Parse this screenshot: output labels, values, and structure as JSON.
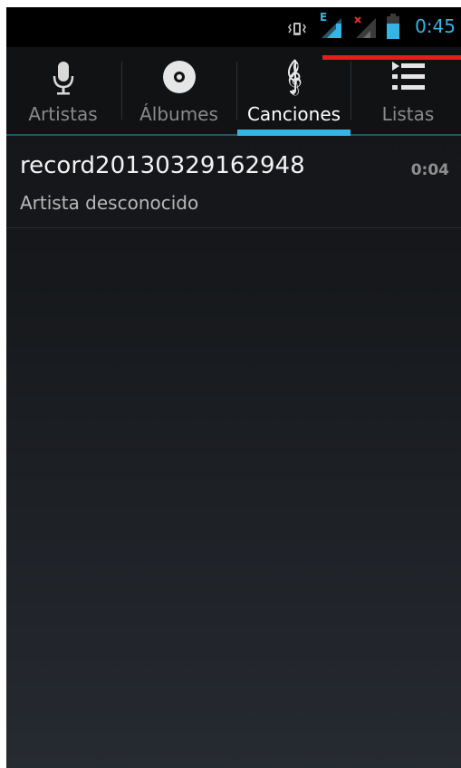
{
  "status_bar": {
    "time": "0:45",
    "signal_1_label": "E",
    "icons": [
      "vibrate-icon",
      "signal-e-icon",
      "signal-no-sim-icon",
      "battery-icon"
    ],
    "accent_color": "#33b5e5"
  },
  "tabs": [
    {
      "label": "Artistas",
      "icon": "microphone-icon",
      "active": false
    },
    {
      "label": "Álbumes",
      "icon": "disc-icon",
      "active": false
    },
    {
      "label": "Canciones",
      "icon": "treble-clef-icon",
      "active": true
    },
    {
      "label": "Listas",
      "icon": "playlist-icon",
      "active": false
    }
  ],
  "songs": [
    {
      "title": "record20130329162948",
      "artist": "Artista desconocido",
      "duration": "0:04"
    }
  ],
  "annotation_color": "#e81c1c"
}
